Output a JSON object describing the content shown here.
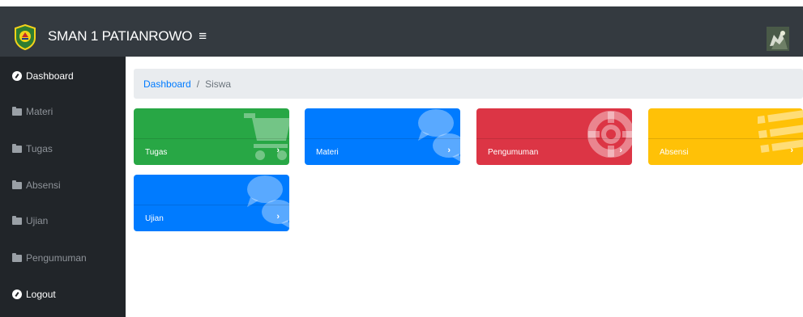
{
  "app": {
    "brand": "SMAN 1 PATIANROWO",
    "toggle": "≡"
  },
  "colors": {
    "navbar": "#343a40",
    "sidebar": "#212529",
    "green": "#28a745",
    "blue": "#007bff",
    "red": "#dc3545",
    "yellow": "#ffc107"
  },
  "sidebar": {
    "items": [
      {
        "label": "Dashboard",
        "icon": "dashboard-icon"
      },
      {
        "label": "Materi",
        "icon": "folder-icon"
      },
      {
        "label": "Tugas",
        "icon": "folder-icon"
      },
      {
        "label": "Absensi",
        "icon": "folder-icon"
      },
      {
        "label": "Ujian",
        "icon": "folder-icon"
      },
      {
        "label": "Pengumuman",
        "icon": "folder-icon"
      },
      {
        "label": "Logout",
        "icon": "help-icon"
      }
    ]
  },
  "breadcrumb": {
    "home": "Dashboard",
    "separator": "/",
    "current": "Siswa"
  },
  "cards": [
    {
      "label": "Tugas",
      "icon": "shopping-cart-icon",
      "color": "green"
    },
    {
      "label": "Materi",
      "icon": "comments-icon",
      "color": "blue"
    },
    {
      "label": "Pengumuman",
      "icon": "life-ring-icon",
      "color": "red"
    },
    {
      "label": "Absensi",
      "icon": "list-icon",
      "color": "yellow"
    },
    {
      "label": "Ujian",
      "icon": "comments-icon",
      "color": "blue"
    }
  ],
  "chevron": "›"
}
